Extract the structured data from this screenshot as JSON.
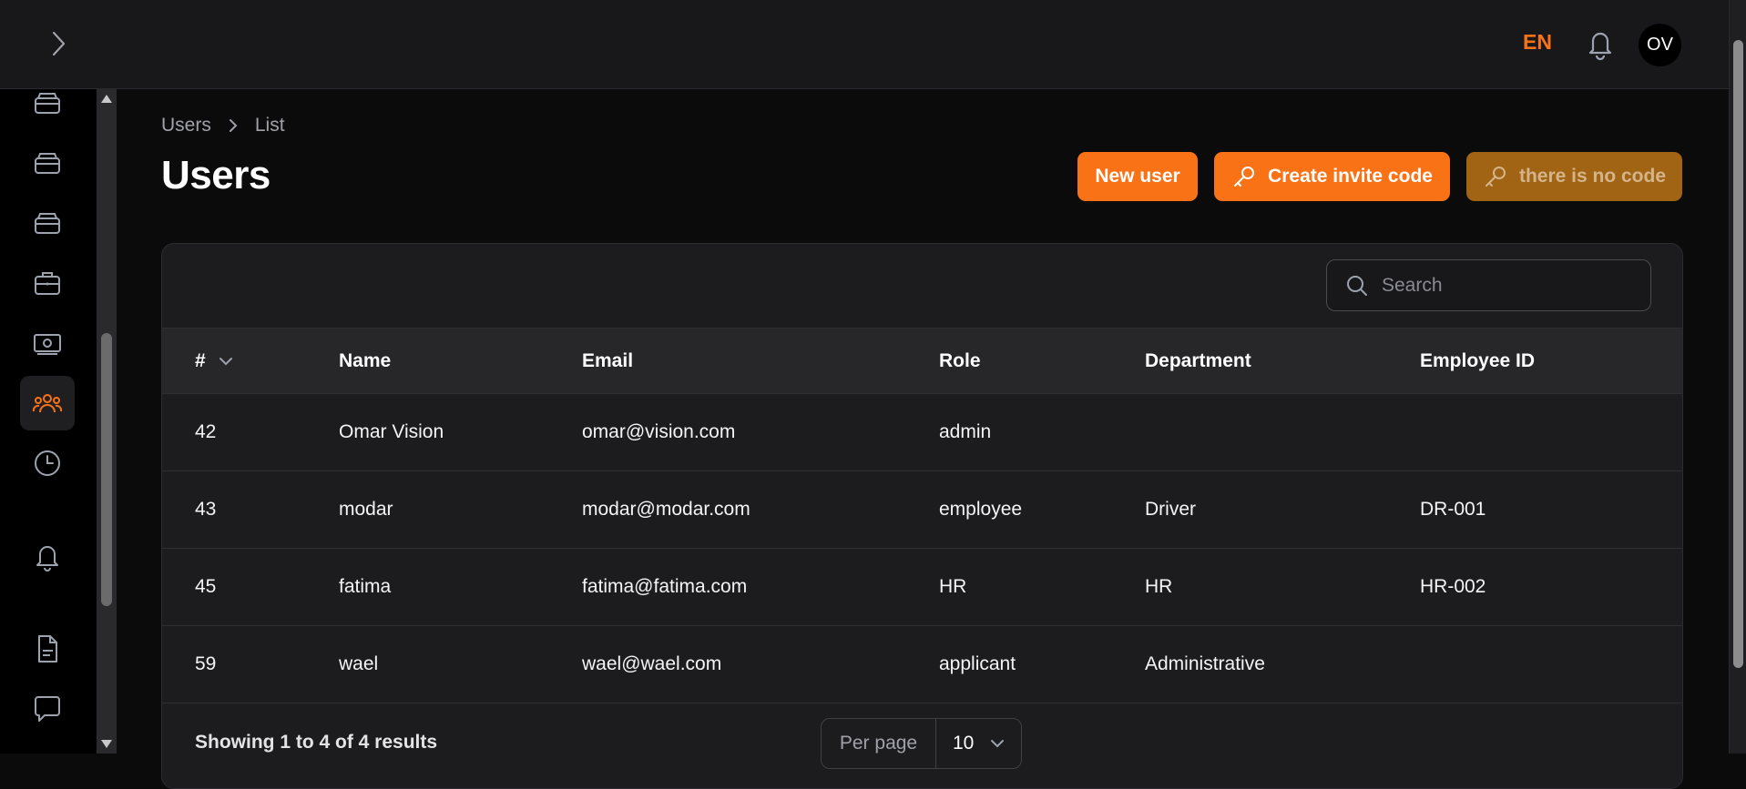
{
  "header": {
    "language": "EN",
    "avatar_initials": "OV"
  },
  "breadcrumb": {
    "items": [
      "Users",
      "List"
    ]
  },
  "page": {
    "title": "Users"
  },
  "actions": {
    "new_user": "New user",
    "create_invite": "Create invite code",
    "no_code": "there is no code"
  },
  "search": {
    "placeholder": "Search"
  },
  "table": {
    "columns": [
      "#",
      "Name",
      "Email",
      "Role",
      "Department",
      "Employee ID"
    ],
    "rows": [
      {
        "id": "42",
        "name": "Omar Vision",
        "email": "omar@vision.com",
        "role": "admin",
        "department": "",
        "employee_id": ""
      },
      {
        "id": "43",
        "name": "modar",
        "email": "modar@modar.com",
        "role": "employee",
        "department": "Driver",
        "employee_id": "DR-001"
      },
      {
        "id": "45",
        "name": "fatima",
        "email": "fatima@fatima.com",
        "role": "HR",
        "department": "HR",
        "employee_id": "HR-002"
      },
      {
        "id": "59",
        "name": "wael",
        "email": "wael@wael.com",
        "role": "applicant",
        "department": "Administrative",
        "employee_id": ""
      }
    ]
  },
  "pagination": {
    "summary": "Showing 1 to 4 of 4 results",
    "per_page_label": "Per page",
    "per_page_value": "10"
  },
  "sidebar": {
    "items": [
      {
        "icon": "inbox-stack-icon"
      },
      {
        "icon": "inbox-stack-icon"
      },
      {
        "icon": "inbox-stack-icon"
      },
      {
        "icon": "briefcase-icon"
      },
      {
        "icon": "banknotes-icon"
      },
      {
        "icon": "users-group-icon",
        "active": true
      },
      {
        "icon": "clock-icon"
      },
      {
        "icon": "bell-icon"
      },
      {
        "icon": "document-icon"
      },
      {
        "icon": "chat-bubble-icon"
      }
    ]
  },
  "colors": {
    "accent": "#f97316",
    "disabled_accent": "#a16314",
    "background": "#0b0b0c",
    "card": "#1c1c1f"
  }
}
